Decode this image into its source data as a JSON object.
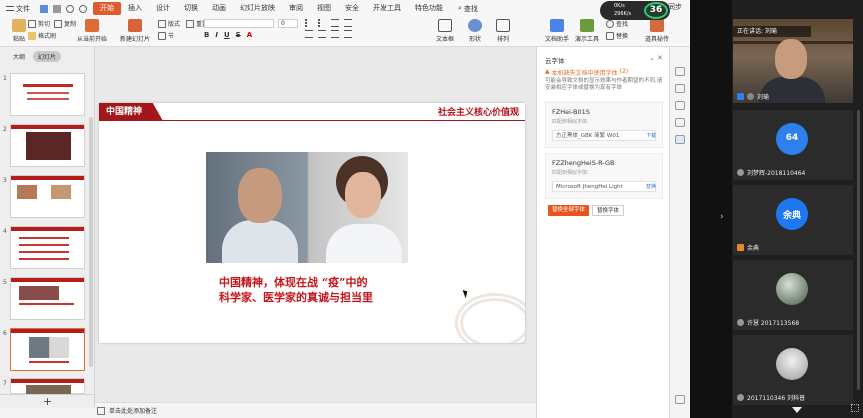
{
  "menubar": {
    "file_label": "文件",
    "tabs": [
      "开始",
      "插入",
      "设计",
      "切换",
      "动画",
      "幻灯片放映",
      "审阅",
      "视图",
      "安全",
      "开发工具",
      "特色功能"
    ],
    "active_tab": "开始",
    "search_label": "查找",
    "sync_status": "未同步"
  },
  "speed_widget": {
    "upload": "0K/s",
    "download": "296K/s",
    "percent": "36"
  },
  "ribbon": {
    "paste": "粘贴",
    "cut": "剪切",
    "copy": "复制",
    "format_painter": "格式刷",
    "from_current": "从当前开始",
    "new_slide": "新建幻灯片",
    "layout": "版式",
    "section": "节",
    "reset": "重置",
    "font_size": "0",
    "text_box": "文本框",
    "shape": "形状",
    "arrange": "排列",
    "doc_assistant": "文档助手",
    "presentation_tools": "演示工具",
    "find": "查找",
    "replace": "替换",
    "select": "选择",
    "talk": "道具秘传"
  },
  "thumbnails": {
    "tab_outline": "大纲",
    "tab_slides": "幻灯片",
    "numbers": [
      "1",
      "2",
      "3",
      "4",
      "5",
      "6",
      "7"
    ],
    "selected": "6",
    "add_label": "+"
  },
  "slide": {
    "tag": "中国精神",
    "subtitle": "社会主义核心价值观",
    "caption_line1": "中国精神，体现在战 “疫”中的",
    "caption_line2": "科学家、医学家的真诚与担当里"
  },
  "statusbar": {
    "note": "单击此处添加备注"
  },
  "font_panel": {
    "title": "云字体",
    "warning": "本机缺失文档中使用字体",
    "count": "(2)",
    "description": "可能会导致文档的显示效果与作者期望的不同,请安装相应字体或替换为现有字体",
    "fonts": [
      {
        "name": "FZHei-B01S",
        "hint": "匹配到相似字体:",
        "suggestion": "方正黑体_GBK 简繁 W01",
        "action": "下载"
      },
      {
        "name": "FZZhengHeiS-R-GB",
        "hint": "匹配到相似字体:",
        "suggestion": "Microsoft JhengHei Light",
        "action": "替换"
      }
    ],
    "primary_button": "替换全部字体",
    "secondary_button": "替换字体"
  },
  "meeting": {
    "speaking_label": "正在讲话: 刘瑜",
    "speaker_name": "刘瑜",
    "participants": [
      {
        "avatar": "64",
        "name": "刘梦辉-2018110464",
        "color": "#2f80ed"
      },
      {
        "avatar": "余典",
        "name": "余典",
        "color": "#1e77f0"
      },
      {
        "avatar": "",
        "name": "许慧 2017113568",
        "color": "#8a9a8c"
      },
      {
        "avatar": "",
        "name": "2017110346 刘科普",
        "color": "#cfcfcf"
      }
    ]
  },
  "colors": {
    "accent": "#e15a2c",
    "slide_red": "#a3171b",
    "caption_red": "#c3161c"
  }
}
